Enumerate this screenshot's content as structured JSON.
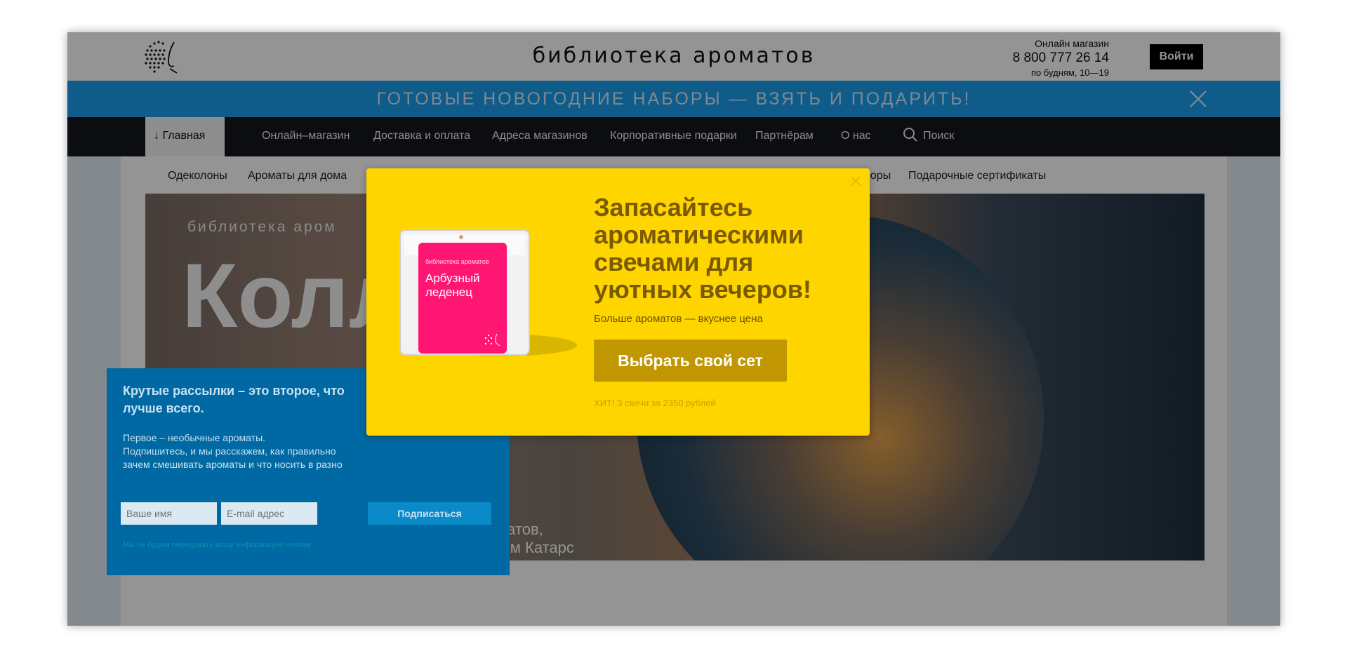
{
  "header": {
    "brand": "библиотека ароматов",
    "shop_label": "Онлайн магазин",
    "phone": "8 800 777 26 14",
    "hours": "по будням, 10—19",
    "login": "Войти"
  },
  "promo": {
    "text": "ГОТОВЫЕ НОВОГОДНИЕ НАБОРЫ — ВЗЯТЬ И ПОДАРИТЬ!"
  },
  "nav": {
    "home": "↓ Главная",
    "items": [
      "Онлайн–магазин",
      "Доставка и оплата",
      "Адреса магазинов",
      "Корпоративные подарки",
      "Партнёрам",
      "О нас"
    ],
    "search": "Поиск"
  },
  "subnav": {
    "items": [
      "Одеколоны",
      "Ароматы для дома",
      "наборы",
      "Подарочные сертификаты"
    ]
  },
  "hero": {
    "lib": "библиотека аром",
    "big": "Колл",
    "line1": "матов,",
    "line2": "гем Катарс"
  },
  "newsletter": {
    "title": "Крутые рассылки – это второе, что лучше всего.",
    "line1": "Первое – необычные ароматы.",
    "line2": "Подпишитесь, и мы расскажем, как правильно",
    "line3": "зачем смешивать ароматы и что носить в разно",
    "name_placeholder": "Ваше имя",
    "email_placeholder": "E-mail адрес",
    "submit": "Подписаться",
    "footnote": "Мы не будем передавать вашу информацию никому"
  },
  "modal": {
    "title": "Запасайтесь ароматическими свечами для уютных вечеров!",
    "subtitle": "Больше ароматов — вкуснее цена",
    "cta": "Выбрать свой сет",
    "hit": "ХИТ! 3 свечи за 2350 рублей",
    "candle_brand": "библиотека ароматов",
    "candle_name_1": "Арбузный",
    "candle_name_2": "леденец"
  },
  "colors": {
    "promo": "#1b9ff0",
    "nav": "#15171c",
    "modal": "#ffd500",
    "cta": "#c09700",
    "newsletter": "#0068a2",
    "candle_label": "#ff1673"
  }
}
